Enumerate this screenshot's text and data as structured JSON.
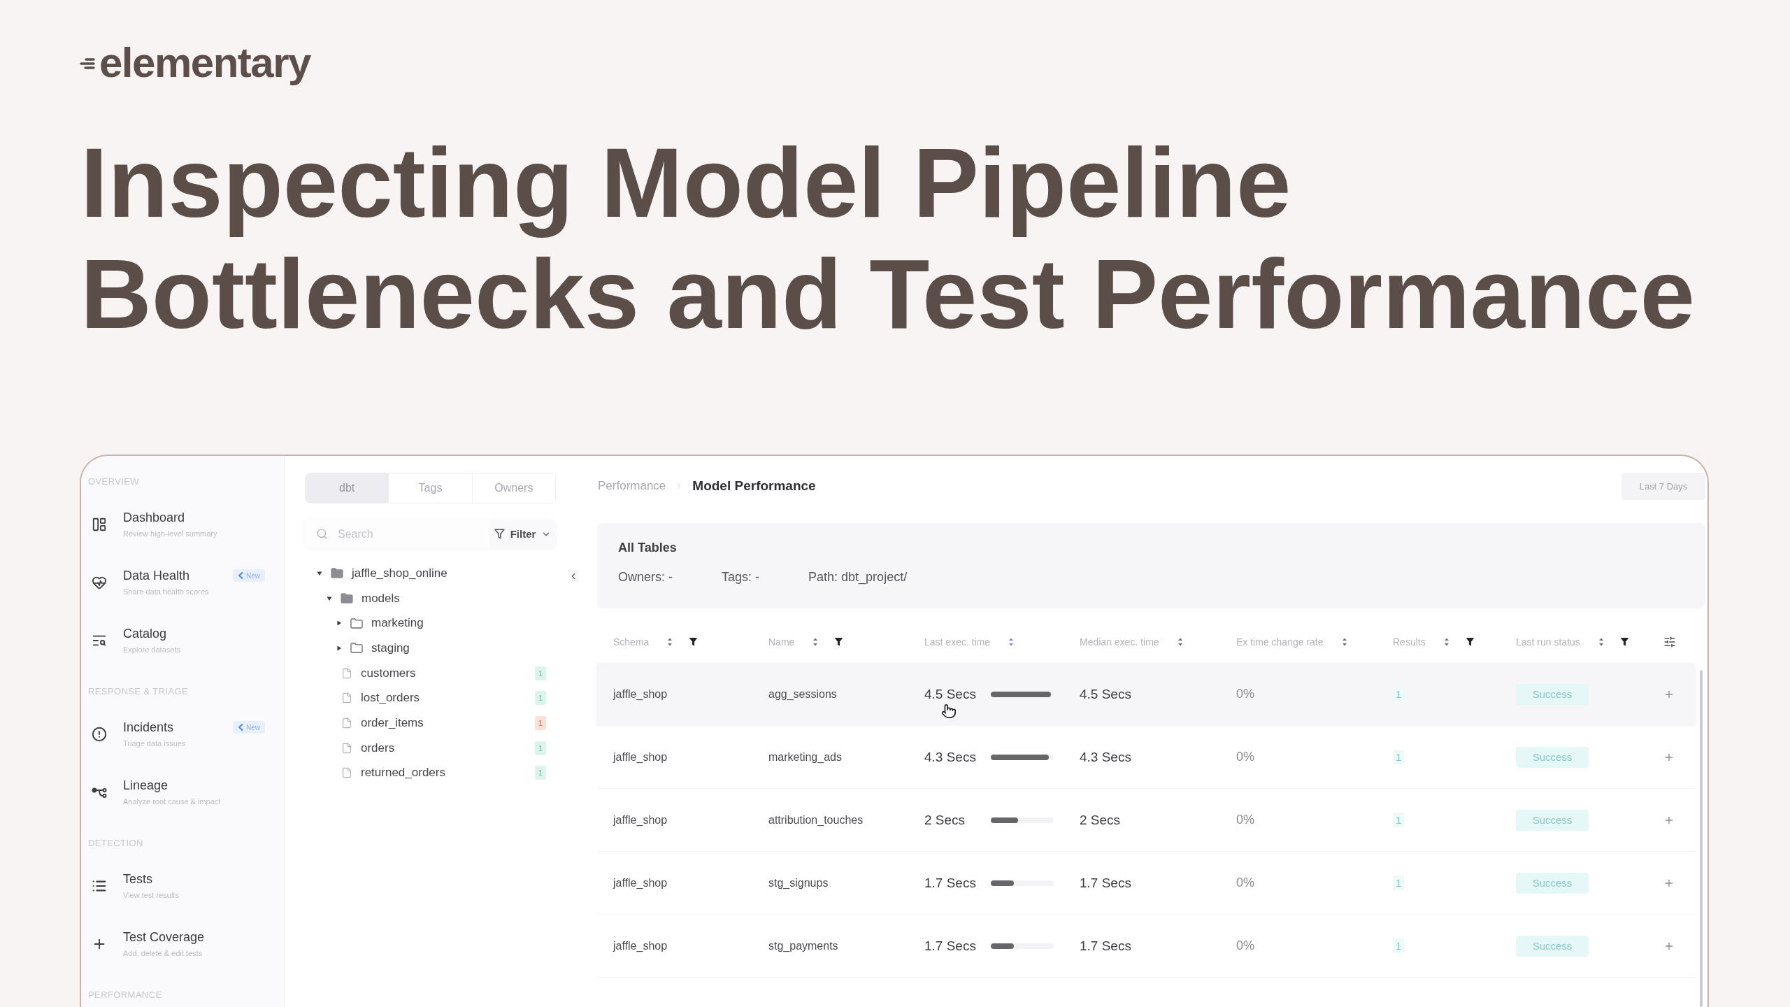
{
  "brand": {
    "name": "elementary"
  },
  "headline": {
    "lines": [
      "Inspecting Model Pipeline",
      "Bottlenecks and Test Performance"
    ]
  },
  "app": {
    "sidebar": {
      "sections": [
        {
          "title": "OVERVIEW",
          "items": [
            {
              "label": "Dashboard",
              "description": "Review high-level summary",
              "selected": false
            },
            {
              "label": "Data Health",
              "description": "Share data health scores",
              "badge": "New",
              "selected": false
            },
            {
              "label": "Catalog",
              "description": "Explore datasets",
              "selected": false
            }
          ]
        },
        {
          "title": "RESPONSE & TRIAGE",
          "items": [
            {
              "label": "Incidents",
              "description": "Triage data issues",
              "badge": "New",
              "selected": false
            },
            {
              "label": "Lineage",
              "description": "Analyze root cause & impact",
              "selected": false
            }
          ]
        },
        {
          "title": "DETECTION",
          "items": [
            {
              "label": "Tests",
              "description": "View test results",
              "selected": false
            },
            {
              "label": "Test Coverage",
              "description": "Add, delete & edit tests",
              "selected": false
            }
          ]
        },
        {
          "title": "PERFORMANCE"
        }
      ]
    },
    "explorer": {
      "tabs": [
        {
          "label": "dbt",
          "selected": true
        },
        {
          "label": "Tags",
          "selected": false
        },
        {
          "label": "Owners",
          "selected": false
        }
      ],
      "search": {
        "placeholder": "Search"
      },
      "filter_button": {
        "label": "Filter"
      },
      "tree": [
        {
          "label": "jaffle_shop_online",
          "kind": "folder",
          "expanded": true,
          "children": [
            {
              "label": "models",
              "kind": "folder",
              "expanded": true,
              "children": [
                {
                  "label": "marketing",
                  "kind": "folder",
                  "expanded": false
                },
                {
                  "label": "staging",
                  "kind": "folder",
                  "expanded": false
                },
                {
                  "label": "customers",
                  "kind": "file",
                  "count": "1",
                  "color": "#dcf4ec"
                },
                {
                  "label": "lost_orders",
                  "kind": "file",
                  "count": "1",
                  "color": "#dcf4ec"
                },
                {
                  "label": "order_items",
                  "kind": "file",
                  "count": "1",
                  "color": "#fde1d6"
                },
                {
                  "label": "orders",
                  "kind": "file",
                  "count": "1",
                  "color": "#dcf4ec"
                },
                {
                  "label": "returned_orders",
                  "kind": "file",
                  "count": "1",
                  "color": "#dcf4ec"
                }
              ]
            }
          ]
        }
      ]
    },
    "main": {
      "breadcrumb": [
        {
          "label": "Performance",
          "current": false
        },
        {
          "label": "Model Performance",
          "current": true
        }
      ],
      "date_range": {
        "label": "Last 7 Days"
      },
      "summary": {
        "title": "All Tables",
        "fields": [
          "Owners: -",
          "Tags: -",
          "Path: dbt_project/"
        ]
      },
      "table": {
        "columns": [
          {
            "label": "Schema",
            "filterable": true,
            "sorted": false
          },
          {
            "label": "Name",
            "filterable": true,
            "sorted": false
          },
          {
            "label": "Last exec. time",
            "filterable": false,
            "sorted": true
          },
          {
            "label": "Median exec. time",
            "filterable": false,
            "sorted": false
          },
          {
            "label": "Ex time change rate",
            "filterable": false,
            "sorted": false
          },
          {
            "label": "Results",
            "filterable": true,
            "sorted": false
          },
          {
            "label": "Last run status",
            "filterable": true,
            "sorted": false
          }
        ],
        "rows": [
          {
            "schema": "jaffle_shop",
            "name": "agg_sessions",
            "last_exec_time": "4.5 Secs",
            "level": 0.96,
            "median_exec_time": "4.5 Secs",
            "change_rate": "0%",
            "results": "1",
            "status": "Success",
            "highlighted": true
          },
          {
            "schema": "jaffle_shop",
            "name": "marketing_ads",
            "last_exec_time": "4.3 Secs",
            "level": 0.92,
            "median_exec_time": "4.3 Secs",
            "change_rate": "0%",
            "results": "1",
            "status": "Success",
            "highlighted": false
          },
          {
            "schema": "jaffle_shop",
            "name": "attribution_touches",
            "last_exec_time": "2 Secs",
            "level": 0.43,
            "median_exec_time": "2 Secs",
            "change_rate": "0%",
            "results": "1",
            "status": "Success",
            "highlighted": false
          },
          {
            "schema": "jaffle_shop",
            "name": "stg_signups",
            "last_exec_time": "1.7 Secs",
            "level": 0.37,
            "median_exec_time": "1.7 Secs",
            "change_rate": "0%",
            "results": "1",
            "status": "Success",
            "highlighted": false
          },
          {
            "schema": "jaffle_shop",
            "name": "stg_payments",
            "last_exec_time": "1.7 Secs",
            "level": 0.37,
            "median_exec_time": "1.7 Secs",
            "change_rate": "0%",
            "results": "1",
            "status": "Success",
            "highlighted": false
          }
        ]
      }
    }
  }
}
